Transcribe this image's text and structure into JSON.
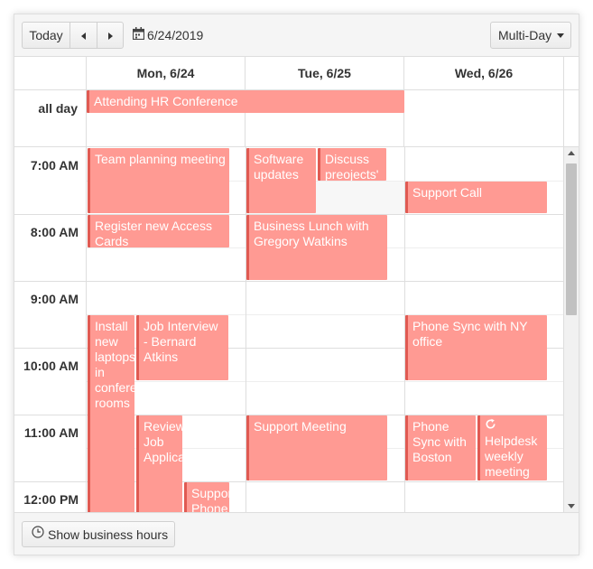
{
  "toolbar": {
    "today_label": "Today",
    "prev_icon": "chevron-left-icon",
    "next_icon": "chevron-right-icon",
    "calendar_icon": "calendar-icon",
    "date": "6/24/2019",
    "view_selected": "Multi-Day"
  },
  "days": [
    {
      "label": "Mon, 6/24"
    },
    {
      "label": "Tue, 6/25"
    },
    {
      "label": "Wed, 6/26"
    }
  ],
  "allday": {
    "label": "all day",
    "events": [
      {
        "title": "Attending HR Conference"
      }
    ]
  },
  "times": [
    "7:00 AM",
    "8:00 AM",
    "9:00 AM",
    "10:00 AM",
    "11:00 AM",
    "12:00 PM"
  ],
  "events": [
    {
      "title": "Team planning meeting"
    },
    {
      "title": "Register new Access Cards"
    },
    {
      "title": "Install new laptops in conference rooms"
    },
    {
      "title": "Job Interview - Bernard Atkins"
    },
    {
      "title": "Review Job Applications"
    },
    {
      "title": "Support Phone Sync"
    },
    {
      "title": "Software updates"
    },
    {
      "title": "Discuss preojects' deliveries"
    },
    {
      "title": "Business Lunch with Gregory Watkins"
    },
    {
      "title": "Support Meeting"
    },
    {
      "title": "Support Call"
    },
    {
      "title": "Phone Sync with NY office"
    },
    {
      "title": "Phone Sync with Boston"
    },
    {
      "title": "Helpdesk weekly meeting",
      "recurring": true,
      "icon": "recurrence-icon"
    }
  ],
  "footer": {
    "business_hours_label": "Show business hours",
    "clock_icon": "clock-icon"
  },
  "colors": {
    "event_fill": "#ff9a93",
    "event_border": "#e05a52",
    "toolbar_bg": "#f5f5f5",
    "grid_line": "#dedede"
  }
}
